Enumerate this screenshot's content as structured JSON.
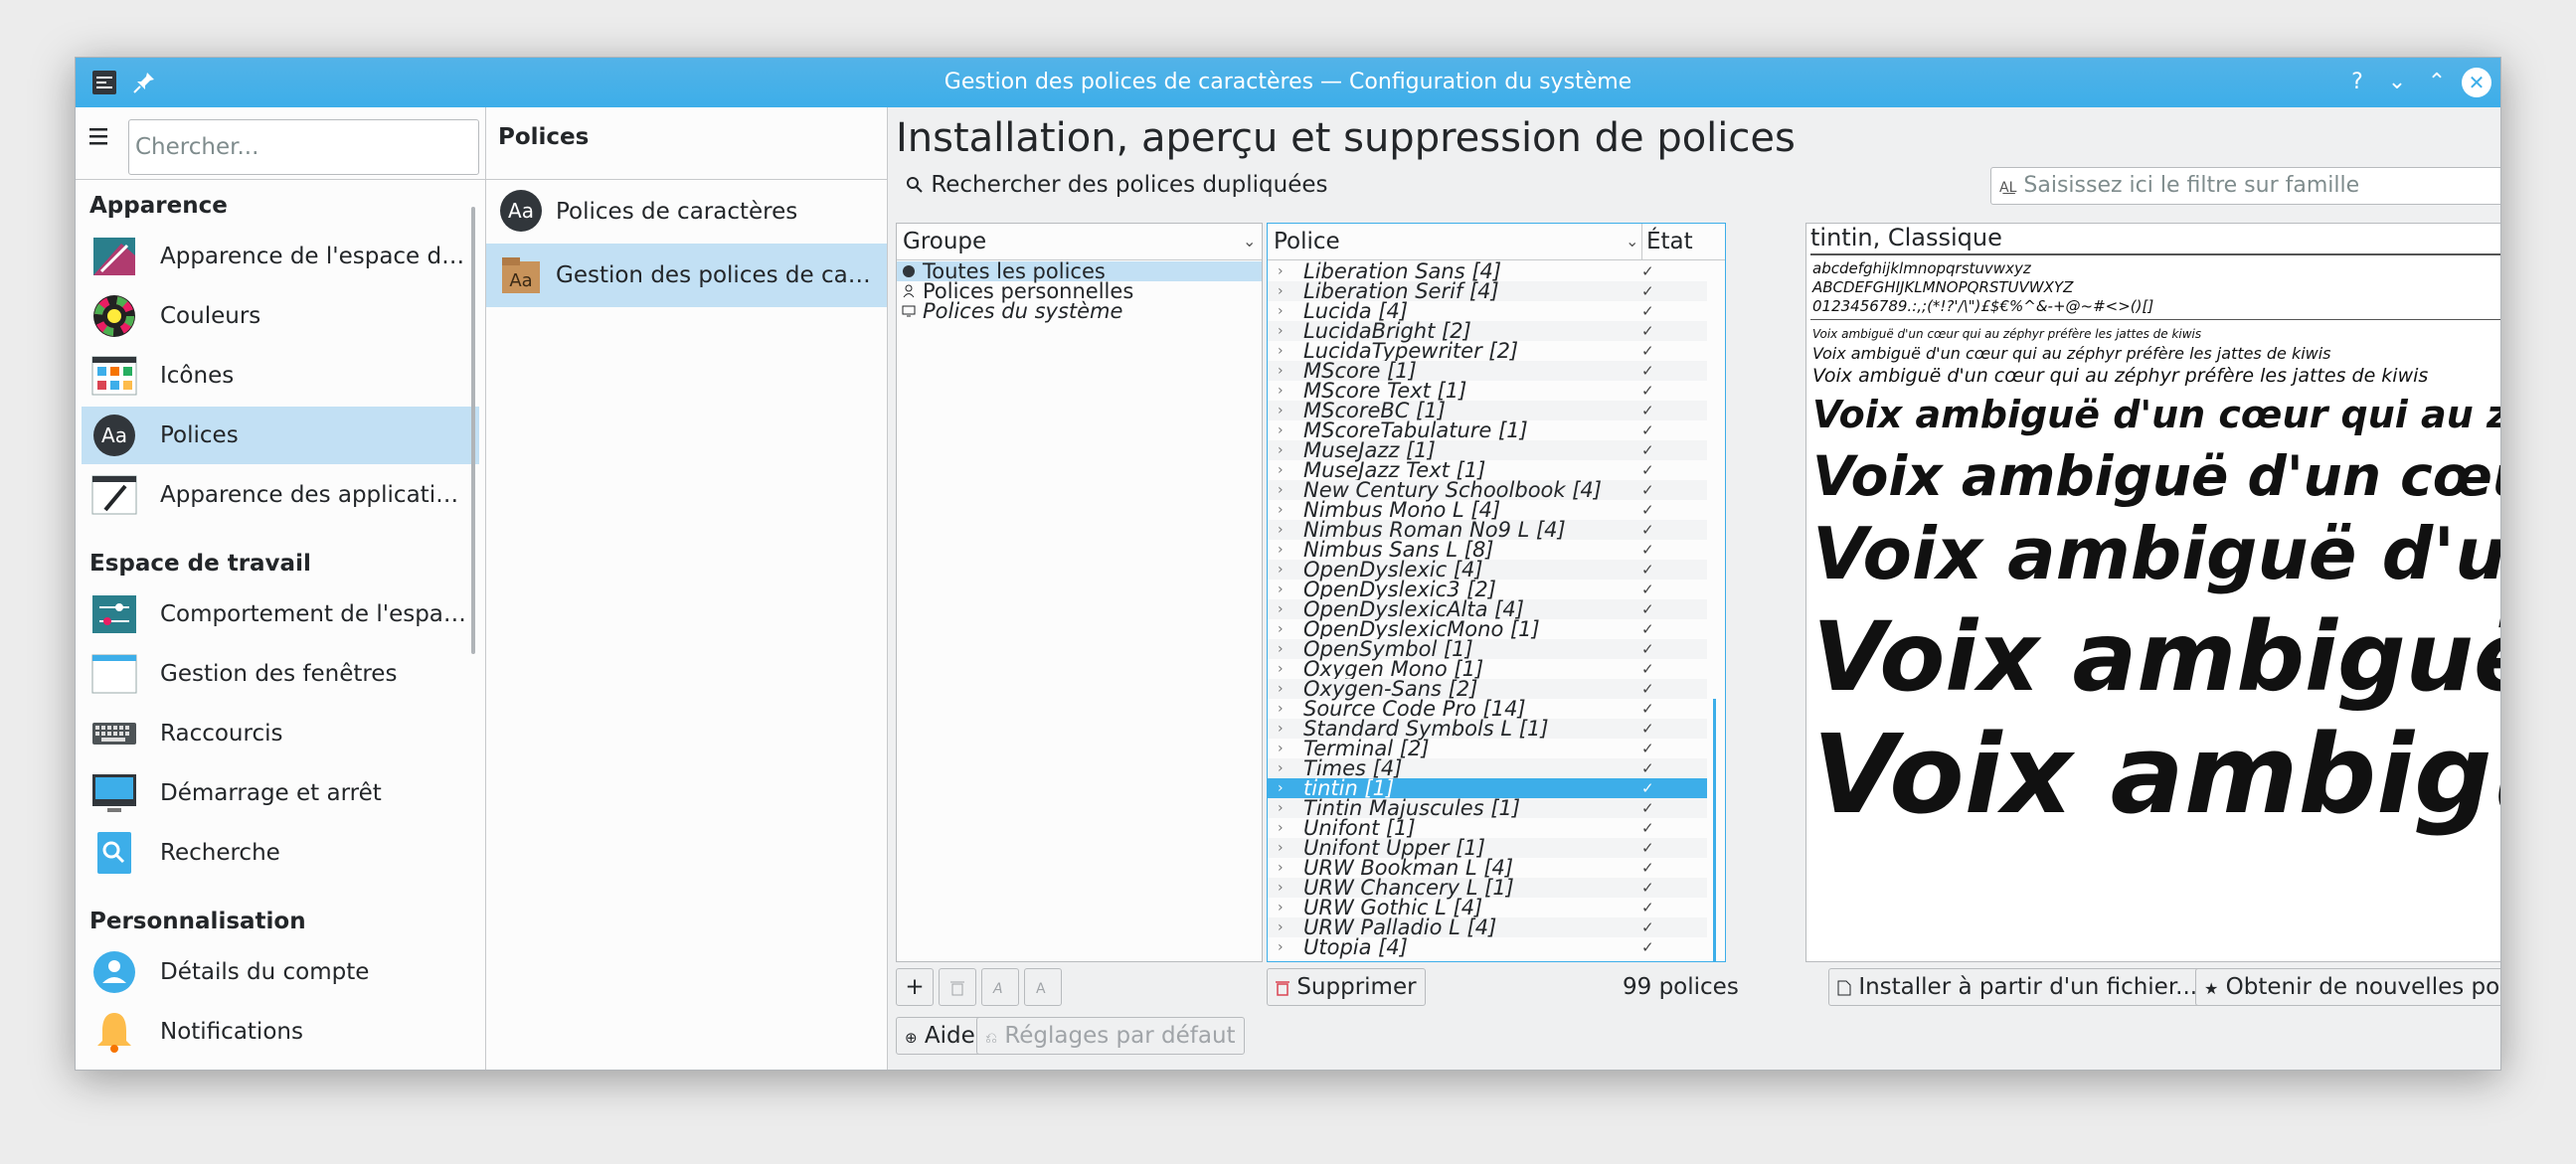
{
  "window": {
    "title": "Gestion des polices de caractères — Configuration du système"
  },
  "titlebar": {
    "help": "?",
    "minimize": "⌄",
    "maximize": "⌃",
    "close": "✕"
  },
  "sidebar": {
    "search_placeholder": "Chercher...",
    "sections": [
      {
        "title": "Apparence",
        "items": [
          {
            "label": "Apparence de l'espace de travail",
            "icon": "workspace-theme-icon"
          },
          {
            "label": "Couleurs",
            "icon": "colors-icon"
          },
          {
            "label": "Icônes",
            "icon": "icons-icon"
          },
          {
            "label": "Polices",
            "icon": "fonts-icon",
            "selected": true
          },
          {
            "label": "Apparence des applications",
            "icon": "app-style-icon"
          }
        ]
      },
      {
        "title": "Espace de travail",
        "items": [
          {
            "label": "Comportement de l'espace de travail",
            "icon": "workspace-behavior-icon"
          },
          {
            "label": "Gestion des fenêtres",
            "icon": "window-management-icon"
          },
          {
            "label": "Raccourcis",
            "icon": "keyboard-icon"
          },
          {
            "label": "Démarrage et arrêt",
            "icon": "startup-shutdown-icon"
          },
          {
            "label": "Recherche",
            "icon": "search-icon"
          }
        ]
      },
      {
        "title": "Personnalisation",
        "items": [
          {
            "label": "Détails du compte",
            "icon": "account-icon"
          },
          {
            "label": "Notifications",
            "icon": "bell-icon"
          }
        ]
      }
    ]
  },
  "middle": {
    "header": "Polices",
    "items": [
      {
        "label": "Polices de caractères",
        "icon": "fonts-icon"
      },
      {
        "label": "Gestion des polices de caractères",
        "icon": "font-management-icon",
        "selected": true
      }
    ]
  },
  "main": {
    "title": "Installation, aperçu et suppression de polices",
    "duplicate_search": "Rechercher des polices dupliquées",
    "filter_placeholder": "Saisissez ici le filtre sur famille",
    "group_header": "Groupe",
    "groups": [
      {
        "label": "Toutes les polices",
        "selected": true
      },
      {
        "label": "Polices personnelles"
      },
      {
        "label": "Polices du système"
      }
    ],
    "font_header": "Police",
    "state_header": "État",
    "fonts": [
      "Liberation Sans [4]",
      "Liberation Serif [4]",
      "Lucida [4]",
      "LucidaBright [2]",
      "LucidaTypewriter [2]",
      "MScore [1]",
      "MScore Text [1]",
      "MScoreBC [1]",
      "MScoreTabulature [1]",
      "MuseJazz [1]",
      "MuseJazz Text [1]",
      "New Century Schoolbook [4]",
      "Nimbus Mono L [4]",
      "Nimbus Roman No9 L [4]",
      "Nimbus Sans L [8]",
      "OpenDyslexic [4]",
      "OpenDyslexic3 [2]",
      "OpenDyslexicAlta [4]",
      "OpenDyslexicMono [1]",
      "OpenSymbol [1]",
      "Oxygen Mono [1]",
      "Oxygen-Sans [2]",
      "Source Code Pro [14]",
      "Standard Symbols L [1]",
      "Terminal [2]",
      "Times [4]",
      "tintin [1]",
      "Tintin Majuscules [1]",
      "Unifont [1]",
      "Unifont Upper [1]",
      "URW Bookman L [4]",
      "URW Chancery L [1]",
      "URW Gothic L [4]",
      "URW Palladio L [4]",
      "Utopia [4]"
    ],
    "selected_font_index": 26,
    "check": "✓",
    "preview": {
      "title": "tintin, Classique",
      "lower": "abcdefghijklmnopqrstuvwxyz",
      "upper": "ABCDEFGHIJKLMNOPQRSTUVWXYZ",
      "digits": "0123456789.:,;(*!?'/\\\")£$€%^&-+@~#<>()[]",
      "sample": "Voix ambiguë d'un cœur qui au zéphyr préfère les jattes de kiwis"
    },
    "buttons": {
      "add": "+",
      "delete": "Supprimer",
      "count": "99 polices",
      "install": "Installer à partir d'un fichier...",
      "get_new": "Obtenir de nouvelles polices...",
      "help": "Aide",
      "defaults": "Réglages par défaut"
    }
  }
}
